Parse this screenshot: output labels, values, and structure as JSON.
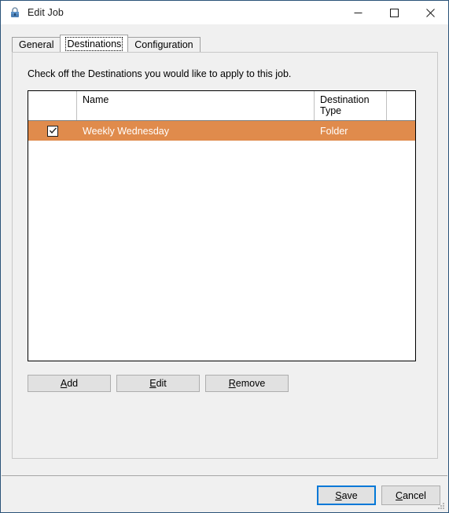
{
  "window": {
    "title": "Edit Job",
    "icon": "padlock-icon",
    "caption_buttons": [
      {
        "name": "minimize-button",
        "glyph": "minimize"
      },
      {
        "name": "maximize-button",
        "glyph": "maximize"
      },
      {
        "name": "close-button",
        "glyph": "close"
      }
    ]
  },
  "tabs": [
    {
      "label": "General",
      "selected": false
    },
    {
      "label": "Destinations",
      "selected": true
    },
    {
      "label": "Configuration",
      "selected": false
    }
  ],
  "panel": {
    "instruction": "Check off the Destinations you would like to apply to this job."
  },
  "grid": {
    "columns": [
      {
        "key": "check",
        "label": ""
      },
      {
        "key": "name",
        "label": "Name"
      },
      {
        "key": "type",
        "label": "Destination Type"
      },
      {
        "key": "extra",
        "label": ""
      }
    ],
    "rows": [
      {
        "checked": true,
        "name": "Weekly Wednesday",
        "type": "Folder",
        "extra": "",
        "selected": true
      }
    ]
  },
  "row_buttons": [
    {
      "name": "add-button",
      "accel": "A",
      "rest": "dd"
    },
    {
      "name": "edit-button",
      "accel": "E",
      "rest": "dit"
    },
    {
      "name": "remove-button",
      "accel": "R",
      "rest": "emove"
    }
  ],
  "footer_buttons": [
    {
      "name": "save-button",
      "accel": "S",
      "rest": "ave",
      "default": true
    },
    {
      "name": "cancel-button",
      "accel": "C",
      "rest": "ancel",
      "default": false
    }
  ],
  "colors": {
    "selection_orange": "#e08b4c",
    "focus_blue": "#0078d7",
    "window_border": "#2b5378",
    "body_background": "#f0f0f0"
  }
}
